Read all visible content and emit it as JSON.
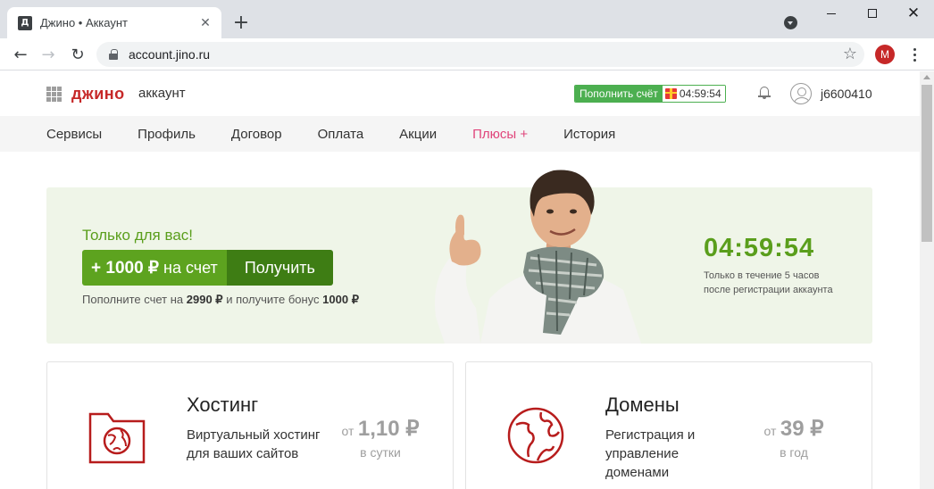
{
  "browser": {
    "tab_title": "Джино • Аккаунт",
    "favicon_letter": "Д",
    "url": "account.jino.ru",
    "profile_letter": "M"
  },
  "header": {
    "logo": "джино",
    "logo_sub": "аккаунт",
    "topup_label": "Пополнить счёт",
    "topup_timer": "04:59:54",
    "username": "j6600410"
  },
  "nav": {
    "items": [
      "Сервисы",
      "Профиль",
      "Договор",
      "Оплата",
      "Акции",
      "Плюсы +",
      "История"
    ]
  },
  "promo": {
    "label": "Только для вас!",
    "amount": "+ 1000 ₽",
    "amount_suffix": "на счет",
    "get_button": "Получить",
    "note_prefix": "Пополните счет на",
    "note_sum": "2990 ₽",
    "note_middle": "и получите бонус",
    "note_bonus": "1000 ₽",
    "countdown": "04:59:54",
    "countdown_note_1": "Только в течение 5 часов",
    "countdown_note_2": "после регистрации аккаунта"
  },
  "cards": [
    {
      "title": "Хостинг",
      "description": "Виртуальный хостинг для ваших сайтов",
      "price_from": "от",
      "price": "1,10 ₽",
      "price_unit": "в сутки"
    },
    {
      "title": "Домены",
      "description": "Регистрация и управление доменами",
      "price_from": "от",
      "price": "39 ₽",
      "price_unit": "в год"
    }
  ],
  "colors": {
    "brand": "#c62828",
    "green": "#5da31f",
    "dark_green": "#3e7d14",
    "plus_pink": "#e0457b"
  }
}
